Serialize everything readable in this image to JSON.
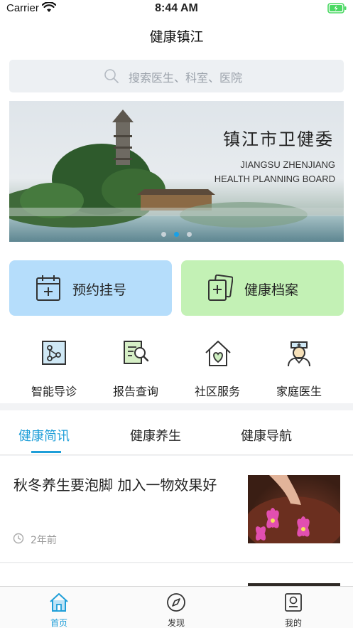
{
  "status_bar": {
    "carrier": "Carrier",
    "time": "8:44 AM",
    "battery_color": "#4cd964"
  },
  "nav": {
    "title": "健康镇江"
  },
  "search": {
    "placeholder": "搜索医生、科室、医院",
    "icon": "search-icon"
  },
  "banner": {
    "title": "镇江市卫健委",
    "subtitle_line1": "JIANGSU ZHENJIANG",
    "subtitle_line2": "HEALTH PLANNING BOARD",
    "page_count": 3,
    "active_page": 1
  },
  "primary_actions": [
    {
      "label": "预约挂号",
      "icon": "calendar-add-icon",
      "color": "#b5ddfb"
    },
    {
      "label": "健康档案",
      "icon": "health-record-icon",
      "color": "#c3f1b5"
    }
  ],
  "quick_links": [
    {
      "label": "智能导诊",
      "icon": "smart-guide-icon"
    },
    {
      "label": "报告查询",
      "icon": "report-search-icon"
    },
    {
      "label": "社区服务",
      "icon": "community-heart-icon"
    },
    {
      "label": "家庭医生",
      "icon": "nurse-doctor-icon"
    }
  ],
  "tabs": [
    {
      "label": "健康简讯",
      "active": true
    },
    {
      "label": "健康养生",
      "active": false
    },
    {
      "label": "健康导航",
      "active": false
    }
  ],
  "news": [
    {
      "title": "秋冬养生要泡脚 加入一物效果好",
      "time": "2年前"
    }
  ],
  "tab_bar": [
    {
      "label": "首页",
      "icon": "home-icon",
      "active": true
    },
    {
      "label": "发现",
      "icon": "compass-icon",
      "active": false
    },
    {
      "label": "我的",
      "icon": "profile-icon",
      "active": false
    }
  ],
  "accent_color": "#1e9ed8"
}
